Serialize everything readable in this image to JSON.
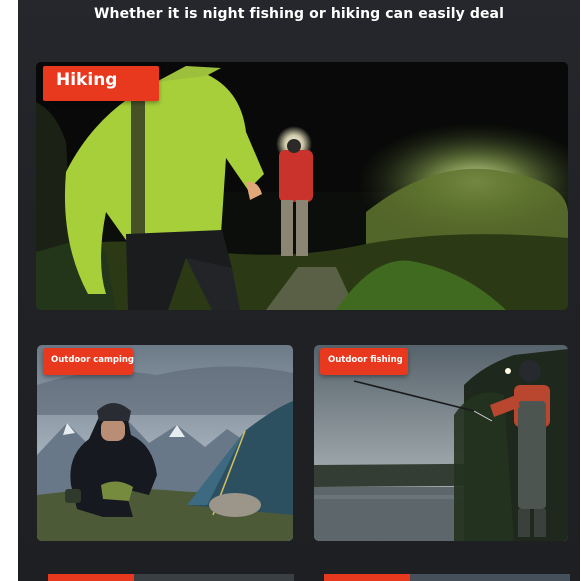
{
  "headline": "Whether it is night fishing or hiking can easily deal",
  "sections": {
    "hiking": {
      "label": "Hiking"
    },
    "camping": {
      "label": "Outdoor camping"
    },
    "fishing": {
      "label": "Outdoor fishing"
    }
  },
  "colors": {
    "panel_background": "#222428",
    "badge": "#e8391f",
    "text": "#ffffff"
  }
}
